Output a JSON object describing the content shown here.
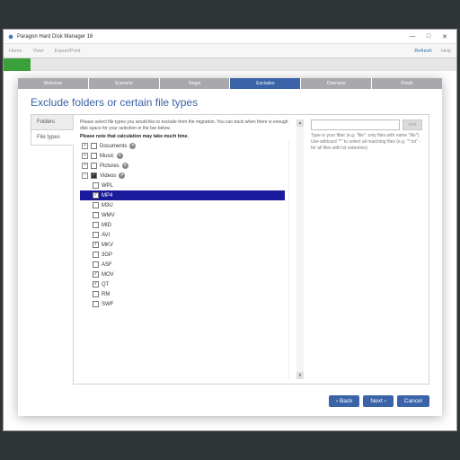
{
  "titlebar": {
    "title": "Paragon Hard Disk Manager 16"
  },
  "winbtns": {
    "min": "—",
    "max": "□",
    "close": "✕"
  },
  "ribbon": {
    "home": "Home",
    "view": "View",
    "export": "Export/Print",
    "refresh": "Refresh",
    "help": "Help"
  },
  "steps": [
    "Welcome",
    "Scenario",
    "Target",
    "Excludes",
    "Overview",
    "Finish"
  ],
  "active_step": 3,
  "heading": "Exclude folders or certain file types",
  "tabs": {
    "folders": "Folders",
    "filetypes": "File types"
  },
  "instr": "Please select file types you would like to exclude from the migration. You can track when there is enough disk space for your selection in the bar below.",
  "note": "Please note that calculation may take much time.",
  "categories": [
    {
      "label": "Documents",
      "state": "unchecked"
    },
    {
      "label": "Music",
      "state": "unchecked"
    },
    {
      "label": "Pictures",
      "state": "unchecked"
    },
    {
      "label": "Videos",
      "state": "minus",
      "expanded": true
    }
  ],
  "video_children": [
    {
      "label": "WPL",
      "checked": false,
      "selected": false
    },
    {
      "label": "MP4",
      "checked": true,
      "selected": true
    },
    {
      "label": "M3U",
      "checked": false,
      "selected": false
    },
    {
      "label": "WMV",
      "checked": false,
      "selected": false
    },
    {
      "label": "MID",
      "checked": false,
      "selected": false
    },
    {
      "label": "AVI",
      "checked": false,
      "selected": false
    },
    {
      "label": "MKV",
      "checked": true,
      "selected": false
    },
    {
      "label": "3GP",
      "checked": false,
      "selected": false
    },
    {
      "label": "ASF",
      "checked": false,
      "selected": false
    },
    {
      "label": "MOV",
      "checked": true,
      "selected": false
    },
    {
      "label": "QT",
      "checked": true,
      "selected": false
    },
    {
      "label": "RM",
      "checked": false,
      "selected": false
    },
    {
      "label": "SWF",
      "checked": false,
      "selected": false
    }
  ],
  "filter": {
    "placeholder": "",
    "add": "Add"
  },
  "hint": "Type in your filter (e.g. \"file\": only files with name \"file\"). Use wildcard \"*\" to select all matching files (e.g. \"*.txt\" - for all files with txt extention).",
  "footer": {
    "back": "‹ Back",
    "next": "Next ›",
    "cancel": "Cancel"
  }
}
